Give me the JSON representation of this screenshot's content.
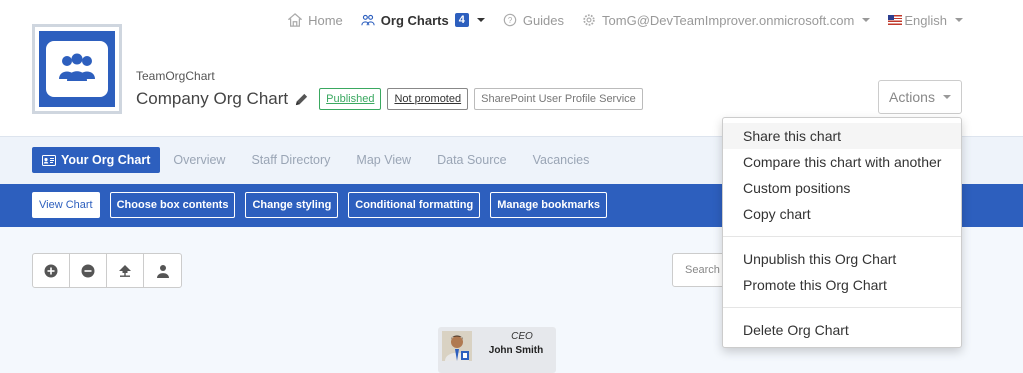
{
  "topnav": {
    "home": "Home",
    "org_charts": "Org Charts",
    "org_charts_count": "4",
    "guides": "Guides",
    "user": "TomG@DevTeamImprover.onmicrosoft.com",
    "language": "English"
  },
  "header": {
    "subtitle": "TeamOrgChart",
    "title": "Company Org Chart",
    "tags": {
      "published": "Published",
      "not_promoted": "Not promoted",
      "source": "SharePoint User Profile Service"
    },
    "actions_label": "Actions"
  },
  "primary_tabs": {
    "your_org_chart": "Your Org Chart",
    "overview": "Overview",
    "staff_directory": "Staff Directory",
    "map_view": "Map View",
    "data_source": "Data Source",
    "vacancies": "Vacancies"
  },
  "secondary_tabs": {
    "view_chart": "View Chart",
    "choose_box_contents": "Choose box contents",
    "change_styling": "Change styling",
    "conditional_formatting": "Conditional formatting",
    "manage_bookmarks": "Manage bookmarks"
  },
  "toolbar": {
    "search_placeholder": "Search t"
  },
  "chart": {
    "root": {
      "role": "CEO",
      "name": "John Smith"
    }
  },
  "actions_menu": {
    "share": "Share this chart",
    "compare": "Compare this chart with another",
    "custom_positions": "Custom positions",
    "copy": "Copy chart",
    "unpublish": "Unpublish this Org Chart",
    "promote": "Promote this Org Chart",
    "delete": "Delete Org Chart"
  },
  "colors": {
    "brand_blue": "#2d5fbe",
    "published_green": "#3aa860"
  }
}
